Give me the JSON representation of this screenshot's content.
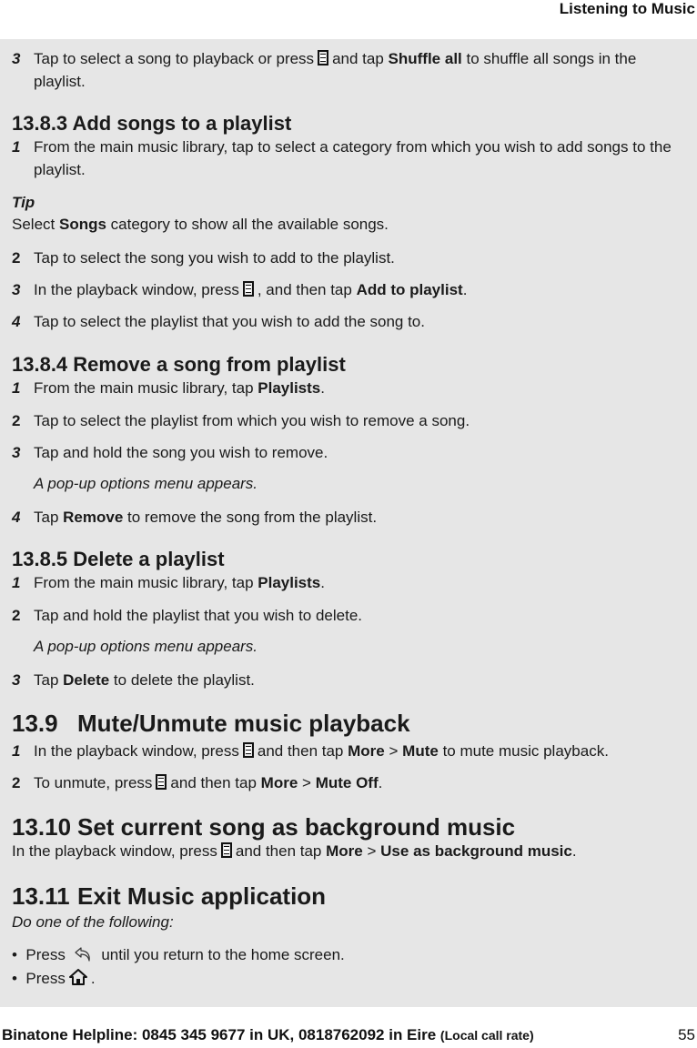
{
  "header": {
    "running_title": "Listening to Music"
  },
  "content": {
    "top_step": {
      "num": "3",
      "pre": "Tap to select a song to playback or press",
      "mid": "and tap",
      "bold": "Shuffle all",
      "post": "to shuffle all songs in the playlist."
    },
    "s1383": {
      "title": "13.8.3 Add songs to a playlist",
      "step1": {
        "num": "1",
        "text": "From the main music library, tap to select a category from which you wish to add songs to the playlist."
      },
      "tip_label": "Tip",
      "tip": {
        "pre": "Select",
        "bold": "Songs",
        "post": "category to show all the available songs."
      },
      "step2": {
        "num": "2",
        "text": "Tap to select the song you wish to add to the playlist."
      },
      "step3": {
        "num": "3",
        "pre": "In the playback window, press",
        "mid": ", and then tap",
        "bold": "Add to playlist",
        "post": "."
      },
      "step4": {
        "num": "4",
        "text": "Tap to select the playlist that you wish to add the song to."
      }
    },
    "s1384": {
      "title": "13.8.4 Remove a song from playlist",
      "step1": {
        "num": "1",
        "pre": "From the main music library, tap",
        "bold": "Playlists",
        "post": "."
      },
      "step2": {
        "num": "2",
        "text": "Tap to select the playlist from which you wish to remove a song."
      },
      "step3": {
        "num": "3",
        "text": "Tap and hold the song you wish to remove."
      },
      "note": "A pop-up options menu appears.",
      "step4": {
        "num": "4",
        "pre": "Tap",
        "bold": "Remove",
        "post": "to remove the song from the playlist."
      }
    },
    "s1385": {
      "title": "13.8.5 Delete a playlist",
      "step1": {
        "num": "1",
        "pre": "From the main music library, tap",
        "bold": "Playlists",
        "post": "."
      },
      "step2": {
        "num": "2",
        "text": "Tap and hold the playlist that you wish to delete."
      },
      "note": "A pop-up options menu appears.",
      "step3": {
        "num": "3",
        "pre": "Tap",
        "bold": "Delete",
        "post": "to delete the playlist."
      }
    },
    "s139": {
      "num": "13.9",
      "title": "Mute/Unmute music playback",
      "step1": {
        "num": "1",
        "pre": "In the playback window, press",
        "mid": "and then tap",
        "bold1": "More",
        "sep": ">",
        "bold2": "Mute",
        "post": "to mute music playback."
      },
      "step2": {
        "num": "2",
        "pre": "To unmute, press",
        "mid": "and then tap",
        "bold1": "More",
        "sep": ">",
        "bold2": "Mute Off",
        "post": "."
      }
    },
    "s1310": {
      "num": "13.10",
      "title": "Set current song as background music",
      "para": {
        "pre": "In the playback window, press",
        "mid": "and then tap",
        "bold1": "More",
        "sep": ">",
        "bold2": "Use as background music",
        "post": "."
      }
    },
    "s1311": {
      "num": "13.11",
      "title": "Exit Music application",
      "intro": "Do one of the following:",
      "bullet1": {
        "pre": "Press",
        "post": "until you return to the home screen."
      },
      "bullet2": {
        "pre": "Press",
        "post": "."
      }
    },
    "icons": {
      "menu": "menu-key-icon",
      "back": "back-arrow-icon",
      "home": "home-icon"
    }
  },
  "footer": {
    "helpline": "Binatone Helpline: 0845 345 9677 in UK, 0818762092 in Eire",
    "rate": "(Local call rate)",
    "page_number": "55"
  }
}
